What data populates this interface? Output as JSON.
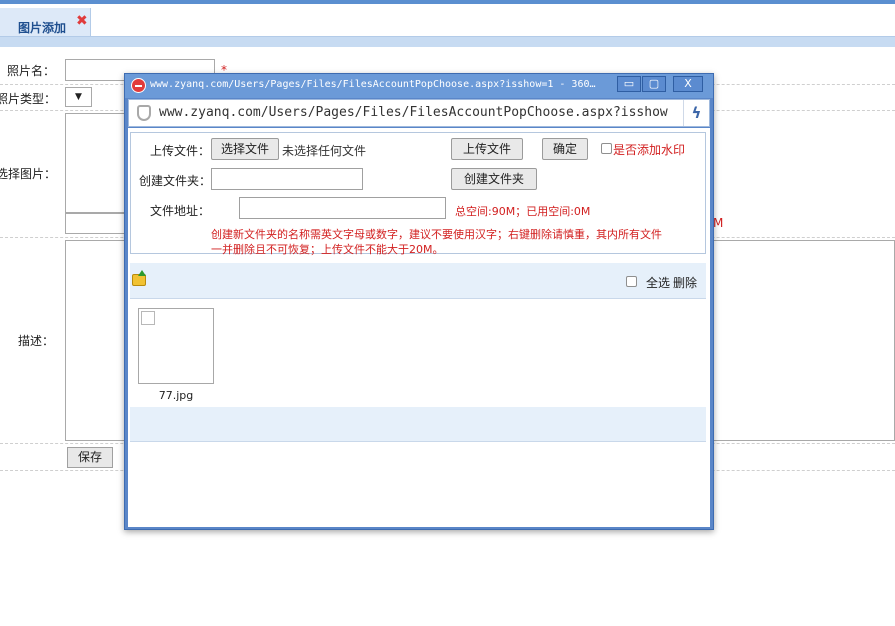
{
  "page": {
    "tab": {
      "label": "图片添加",
      "close_glyph": "✖"
    },
    "form": {
      "photo_name_label": "照片名：",
      "photo_type_label": "照片类型：",
      "select_image_label": "选择图片：",
      "description_label": "描述：",
      "required_mark": "*",
      "type_select_value": "▼",
      "save_label": "保存",
      "truncated_red_text": "M"
    }
  },
  "popup": {
    "title": "www.zyanq.com/Users/Pages/Files/FilesAccountPopChoose.aspx?isshow=1 - 360…",
    "url": "www.zyanq.com/Users/Pages/Files/FilesAccountPopChoose.aspx?isshow",
    "window_buttons": {
      "minimize": "▭",
      "maximize": "▢",
      "close": "X"
    },
    "icons": {
      "logo": "360-logo-icon",
      "shield": "shield-icon",
      "speed": "bolt-icon"
    },
    "bolt_glyph": "ϟ",
    "upload": {
      "upload_file_label": "上传文件：",
      "choose_file_button": "选择文件",
      "no_file_chosen": "未选择任何文件",
      "upload_button": "上传文件",
      "confirm_button": "确定",
      "watermark_label": "是否添加水印",
      "create_folder_label": "创建文件夹：",
      "create_folder_button": "创建文件夹",
      "file_address_label": "文件地址：",
      "space_info": "总空间:90M；已用空间:0M",
      "hint_line1": "创建新文件夹的名称需英文字母或数字，建议不要使用汉字；右键删除请慎重，其内所有文件",
      "hint_line2": "一并删除且不可恢复；上传文件不能大于20M。"
    },
    "toolbar": {
      "select_all": "全选",
      "delete": "删除"
    },
    "files": [
      {
        "name": "77.jpg"
      }
    ]
  },
  "colors": {
    "accent": "#5b8fd0",
    "warning_red": "#d21f1f",
    "panel_blue": "#e6f0fa"
  }
}
